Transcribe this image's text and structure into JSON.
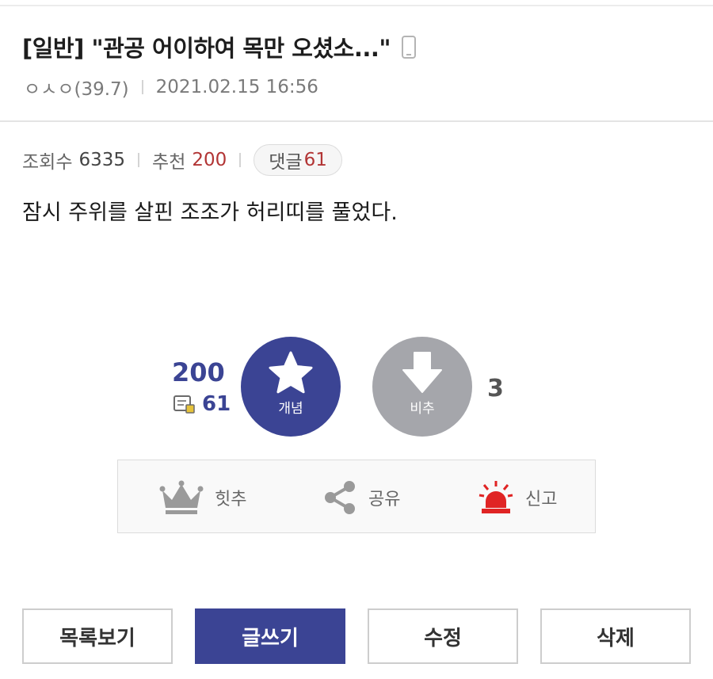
{
  "post": {
    "title": "[일반] \"관공 어이하여 목만 오셨소...\"",
    "author": "ㅇㅅㅇ(39.7)",
    "datetime": "2021.02.15 16:56",
    "device_icon": "mobile-phone-icon"
  },
  "stats": {
    "views_label": "조회수",
    "views": "6335",
    "recommend_label": "추천",
    "recommend": "200",
    "comments_label": "댓글",
    "comments": "61"
  },
  "content": {
    "text": "잠시 주위를 살핀 조조가 허리띠를 풀었다."
  },
  "vote": {
    "up_count": "200",
    "comment_count": "61",
    "up_label": "개념",
    "down_label": "비추",
    "down_count": "3",
    "up_color": "#3b4494",
    "down_color": "#a5a6ab"
  },
  "actions": {
    "best_label": "힛추",
    "share_label": "공유",
    "report_label": "신고",
    "best_icon": "crown-icon",
    "share_icon": "share-icon",
    "report_icon": "siren-icon"
  },
  "buttons": {
    "list": "목록보기",
    "write": "글쓰기",
    "edit": "수정",
    "delete": "삭제"
  },
  "colors": {
    "accent": "#3b4494",
    "red": "#b23535",
    "siren": "#e02424"
  }
}
